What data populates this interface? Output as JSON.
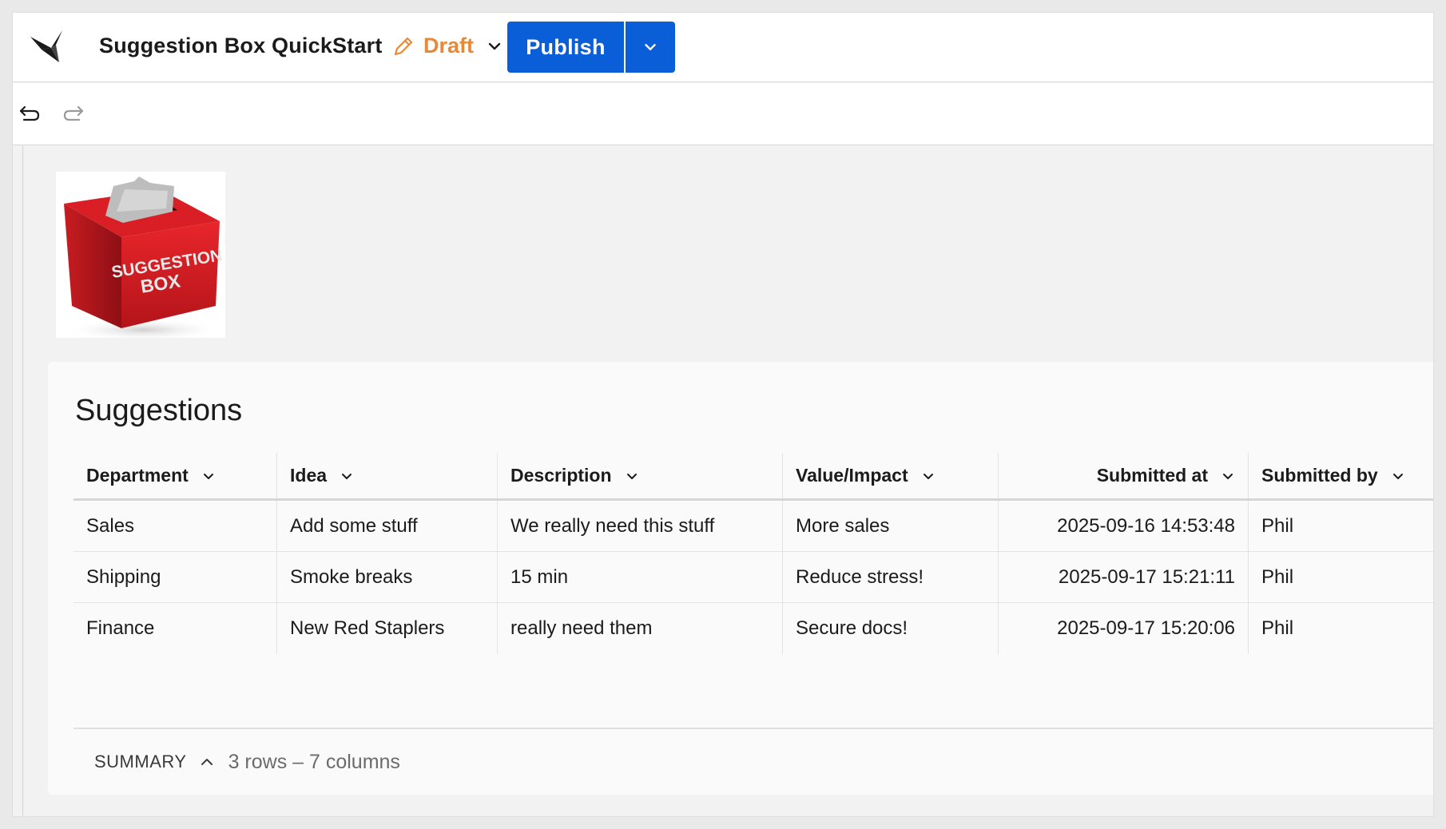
{
  "header": {
    "title": "Suggestion Box QuickStart",
    "status": "Draft",
    "status_color": "#e8893a",
    "publish_label": "Publish",
    "accent": "#0a5ed7"
  },
  "toolbar": {
    "undo_icon": "undo-icon",
    "redo_icon": "redo-icon"
  },
  "image": {
    "line1": "SUGGESTION",
    "line2": "BOX"
  },
  "table": {
    "title": "Suggestions",
    "columns": [
      "Department",
      "Idea",
      "Description",
      "Value/Impact",
      "Submitted at",
      "Submitted by"
    ],
    "rows": [
      [
        "Sales",
        "Add some stuff",
        "We really need this stuff",
        "More sales",
        "2025-09-16 14:53:48",
        "Phil"
      ],
      [
        "Shipping",
        "Smoke breaks",
        "15 min",
        "Reduce stress!",
        "2025-09-17 15:21:11",
        "Phil"
      ],
      [
        "Finance",
        "New Red Staplers",
        "really need them",
        "Secure docs!",
        "2025-09-17 15:20:06",
        "Phil"
      ]
    ],
    "summary_label": "SUMMARY",
    "summary_count": "3 rows – 7 columns"
  }
}
